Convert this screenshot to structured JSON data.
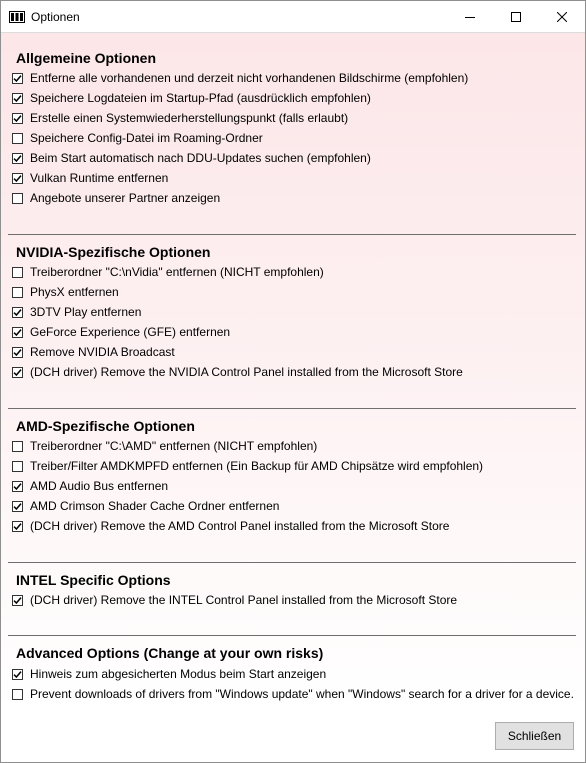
{
  "window": {
    "title": "Optionen",
    "close_button": "Schließen"
  },
  "sections": [
    {
      "title": "Allgemeine Optionen",
      "options": [
        {
          "label": "Entferne alle vorhandenen und derzeit nicht vorhandenen Bildschirme (empfohlen)",
          "checked": true
        },
        {
          "label": "Speichere Logdateien im Startup-Pfad (ausdrücklich empfohlen)",
          "checked": true
        },
        {
          "label": "Erstelle einen Systemwiederherstellungspunkt (falls erlaubt)",
          "checked": true
        },
        {
          "label": "Speichere Config-Datei im Roaming-Ordner",
          "checked": false
        },
        {
          "label": "Beim Start automatisch nach DDU-Updates suchen (empfohlen)",
          "checked": true
        },
        {
          "label": "Vulkan Runtime entfernen",
          "checked": true
        },
        {
          "label": "Angebote unserer Partner anzeigen",
          "checked": false
        }
      ]
    },
    {
      "title": "NVIDIA-Spezifische Optionen",
      "options": [
        {
          "label": "Treiberordner \"C:\\nVidia\" entfernen (NICHT empfohlen)",
          "checked": false
        },
        {
          "label": "PhysX entfernen",
          "checked": false
        },
        {
          "label": "3DTV Play entfernen",
          "checked": true
        },
        {
          "label": "GeForce Experience (GFE) entfernen",
          "checked": true
        },
        {
          "label": "Remove NVIDIA Broadcast",
          "checked": true
        },
        {
          "label": "(DCH driver) Remove the NVIDIA Control Panel installed from the Microsoft Store",
          "checked": true
        }
      ]
    },
    {
      "title": "AMD-Spezifische Optionen",
      "options": [
        {
          "label": "Treiberordner \"C:\\AMD\" entfernen (NICHT empfohlen)",
          "checked": false
        },
        {
          "label": "Treiber/Filter AMDKMPFD entfernen (Ein Backup für AMD Chipsätze wird empfohlen)",
          "checked": false
        },
        {
          "label": "AMD Audio Bus entfernen",
          "checked": true
        },
        {
          "label": "AMD Crimson Shader Cache Ordner entfernen",
          "checked": true
        },
        {
          "label": "(DCH driver) Remove the AMD Control Panel installed from the Microsoft Store",
          "checked": true
        }
      ]
    },
    {
      "title": "INTEL Specific Options",
      "options": [
        {
          "label": "(DCH driver) Remove the INTEL Control Panel installed from the Microsoft Store",
          "checked": true
        }
      ]
    },
    {
      "title": "Advanced Options (Change at your own risks)",
      "options": [
        {
          "label": "Hinweis zum abgesicherten Modus beim Start anzeigen",
          "checked": true
        },
        {
          "label": "Prevent downloads of drivers from \"Windows update\" when \"Windows\" search for a driver for a device.",
          "checked": false
        }
      ]
    }
  ]
}
